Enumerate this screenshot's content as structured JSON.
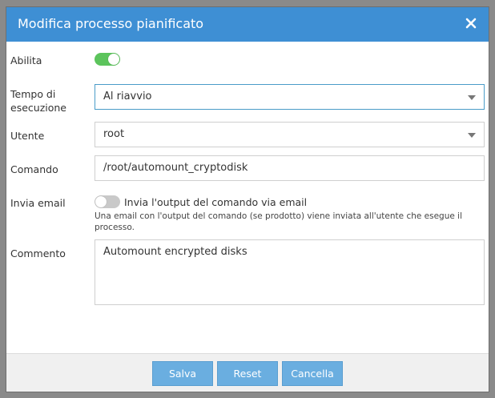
{
  "dialog": {
    "title": "Modifica processo pianificato"
  },
  "form": {
    "enable": {
      "label": "Abilita",
      "value": true
    },
    "schedule": {
      "label": "Tempo di esecuzione",
      "value": "Al riavvio"
    },
    "user": {
      "label": "Utente",
      "value": "root"
    },
    "command": {
      "label": "Comando",
      "value": "/root/automount_cryptodisk"
    },
    "send_email": {
      "label": "Invia email",
      "value": false,
      "checkbox_label": "Invia l'output del comando via email",
      "help": "Una email con l'output del comando (se prodotto) viene inviata all'utente che esegue il processo."
    },
    "comment": {
      "label": "Commento",
      "value": "Automount encrypted disks"
    }
  },
  "footer": {
    "save_label": "Salva",
    "reset_label": "Reset",
    "cancel_label": "Cancella"
  },
  "colors": {
    "titlebar": "#3e8fd4",
    "toggle_on": "#5cc45c",
    "button": "#6aaee0"
  }
}
